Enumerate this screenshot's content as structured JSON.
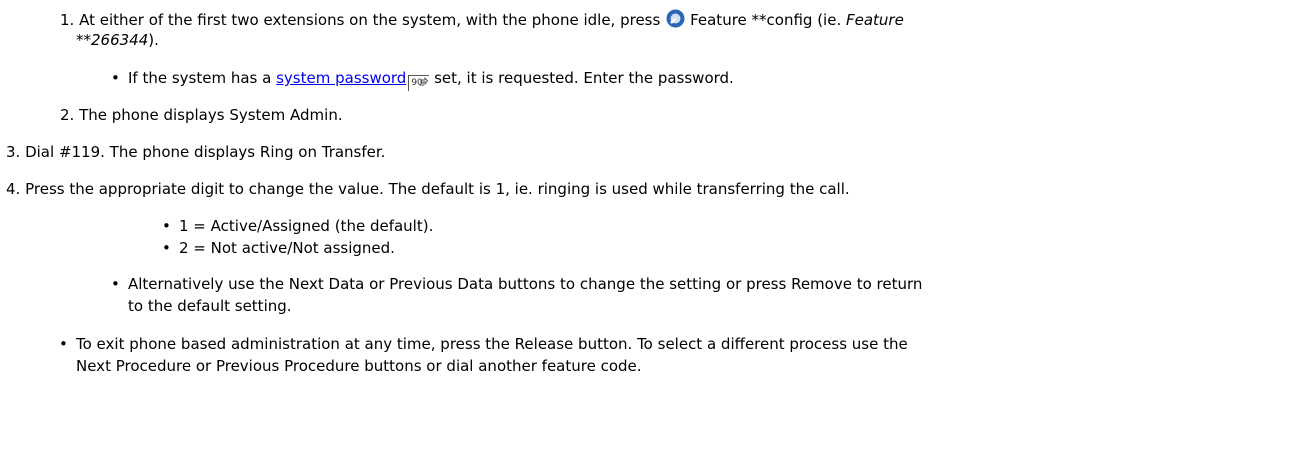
{
  "step1": {
    "number": "1.",
    "text_a": "At either of the first two extensions on the system, with the phone idle, press ",
    "icon": "feature-button-icon",
    "text_b": "Feature **config (ie. ",
    "italic_a": "Feature",
    "italic_b": "**266344",
    "text_c": ")."
  },
  "sub1": {
    "text_a": "If the system has a ",
    "link": "system password",
    "ref": "90",
    "text_b": " set, it is requested. Enter the password."
  },
  "step2": {
    "number": "2.",
    "text": "The phone displays System Admin."
  },
  "step3": {
    "number": "3.",
    "text": "Dial #119. The phone displays Ring on Transfer."
  },
  "step4": {
    "number": "4.",
    "text": "Press the appropriate digit to change the value. The default is 1, ie. ringing is used while transferring the call."
  },
  "options": [
    "1 = Active/Assigned (the default).",
    "2 = Not active/Not assigned."
  ],
  "alt": {
    "line1": "Alternatively use the Next Data or Previous Data buttons to change the setting or press Remove to return",
    "line2": "to the default setting."
  },
  "exit": {
    "line1": "To exit phone based administration at any time, press the Release button. To select a different process use the",
    "line2": "Next Procedure or Previous Procedure buttons or dial another feature code."
  },
  "colors": {
    "link": "#0000ee",
    "icon_blue": "#2a66b3"
  }
}
